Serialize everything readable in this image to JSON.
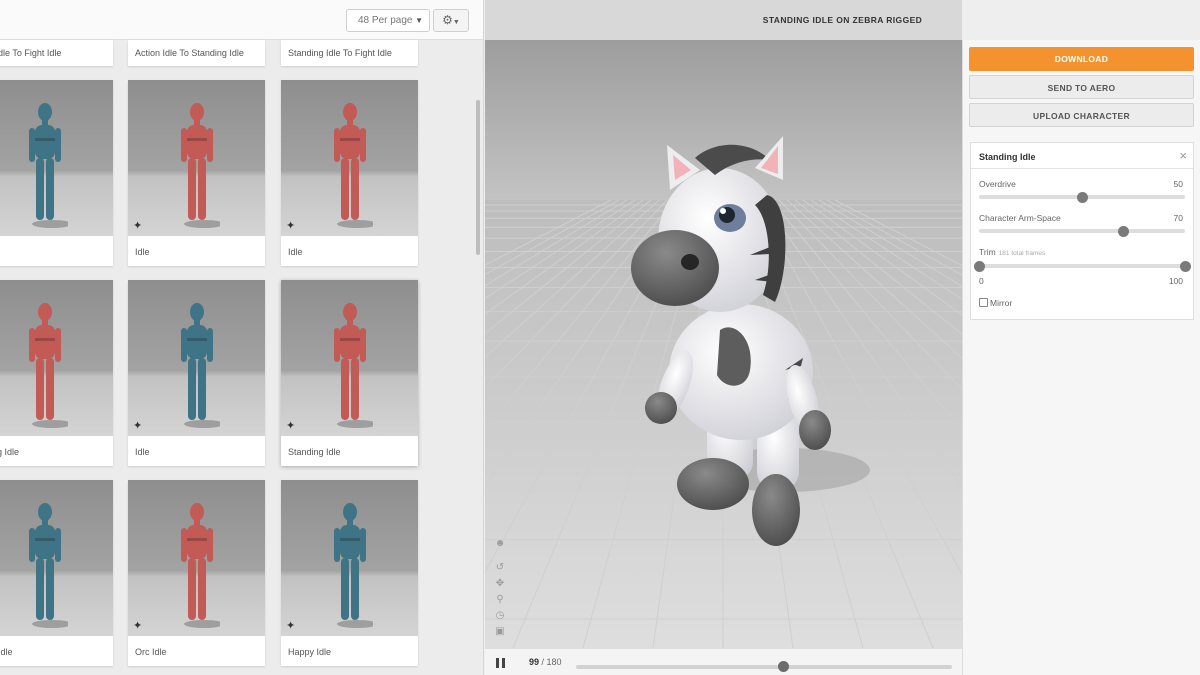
{
  "library": {
    "per_page": "48 Per page",
    "settings_icon": "gear-icon",
    "top_row": [
      "on Idle To Fight Idle",
      "Action Idle To Standing Idle",
      "Standing Idle To Fight Idle"
    ],
    "rows": [
      [
        {
          "label": "",
          "color": "#3f7486"
        },
        {
          "label": "Idle",
          "color": "#c25a55"
        },
        {
          "label": "Idle",
          "color": "#c25a55"
        }
      ],
      [
        {
          "label": "eling Idle",
          "color": "#c25a55"
        },
        {
          "label": "Idle",
          "color": "#3f7486"
        },
        {
          "label": "Standing Idle",
          "color": "#c25a55"
        }
      ],
      [
        {
          "label": "tral Idle",
          "color": "#3f7486"
        },
        {
          "label": "Orc Idle",
          "color": "#c25a55"
        },
        {
          "label": "Happy Idle",
          "color": "#3f7486"
        }
      ]
    ]
  },
  "viewer": {
    "title": "STANDING IDLE ON ZEBRA RIGGED",
    "frame_current": "99",
    "frame_total": "/ 180",
    "progress": 0.55,
    "tools": [
      "face-icon",
      "undo-icon",
      "move-icon",
      "zoom-icon",
      "clock-icon",
      "camera-icon"
    ]
  },
  "panel": {
    "download": "DOWNLOAD",
    "send_to_aero": "SEND TO AERO",
    "upload_character": "UPLOAD CHARACTER",
    "animation_name": "Standing Idle",
    "close_symbol": "×",
    "overdrive": {
      "label": "Overdrive",
      "value": "50",
      "fraction": 0.5
    },
    "arm_space": {
      "label": "Character Arm-Space",
      "value": "70",
      "fraction": 0.7
    },
    "trim": {
      "label": "Trim",
      "sub": "181 total frames",
      "min": "0",
      "max": "100",
      "start": 0.0,
      "end": 1.0
    },
    "mirror": "Mirror"
  },
  "colors": {
    "accent": "#f4922f",
    "blue_character": "#3f7486",
    "red_character": "#c25a55"
  }
}
